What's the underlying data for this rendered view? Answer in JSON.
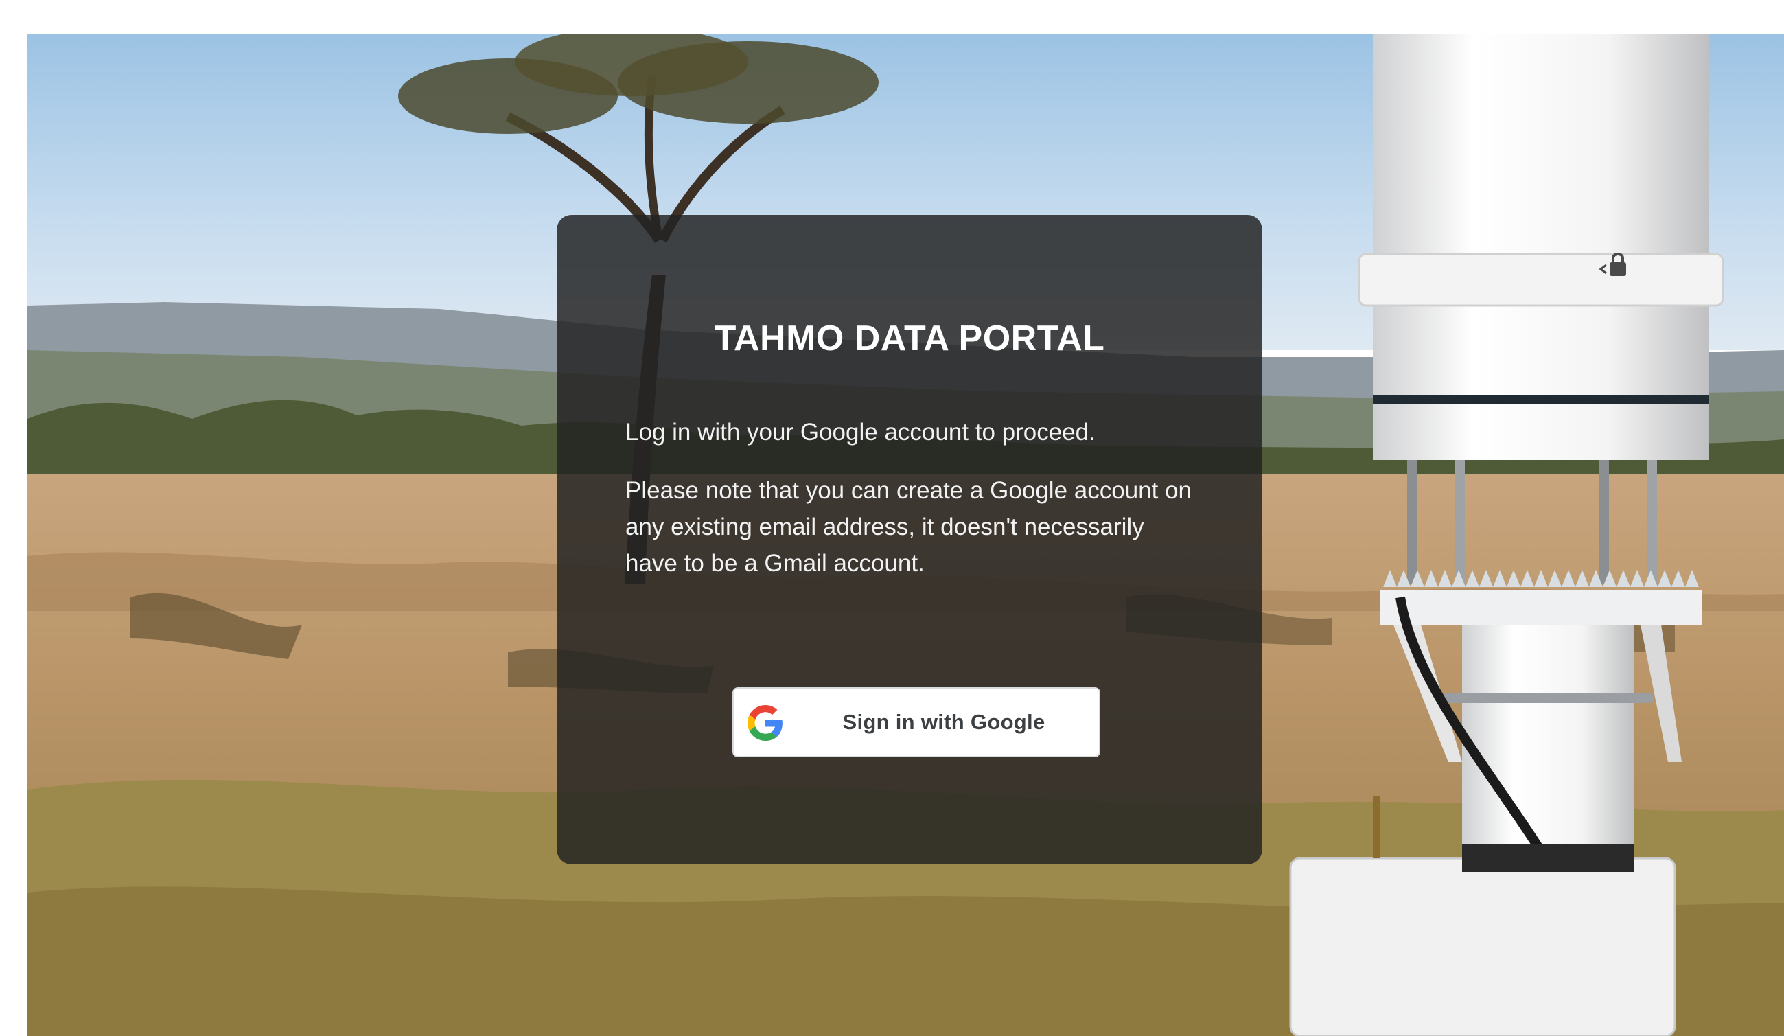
{
  "portal": {
    "title": "TAHMO DATA PORTAL",
    "intro": "Log in with your Google account to proceed.",
    "note": "Please note that you can create a Google account on any existing email address, it doesn't necessarily have to be a Gmail account.",
    "sign_in_label": "Sign in with Google"
  },
  "icons": {
    "google": "google-g-icon",
    "padlock": "padlock-icon"
  },
  "colors": {
    "card_background": "#222222",
    "button_background": "#ffffff",
    "button_text": "#3c4043",
    "google_blue": "#4285F4",
    "google_red": "#EA4335",
    "google_yellow": "#FBBC05",
    "google_green": "#34A853"
  }
}
